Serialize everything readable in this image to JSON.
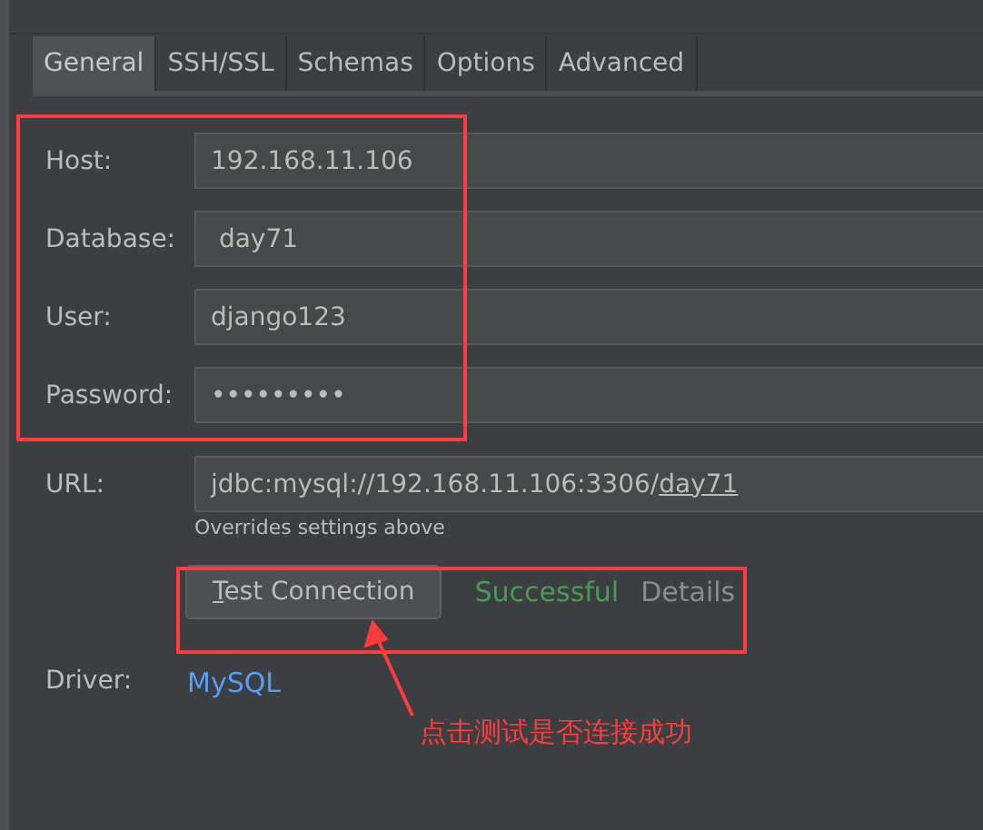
{
  "tabs": [
    {
      "label": "General",
      "selected": true
    },
    {
      "label": "SSH/SSL",
      "selected": false
    },
    {
      "label": "Schemas",
      "selected": false
    },
    {
      "label": "Options",
      "selected": false
    },
    {
      "label": "Advanced",
      "selected": false
    }
  ],
  "fields": [
    {
      "label": "Host:",
      "value": "192.168.11.106"
    },
    {
      "label": "Database:",
      "value": " day71"
    },
    {
      "label": "User:",
      "value": "django123"
    },
    {
      "label": "Password:",
      "value": "•••••••••"
    }
  ],
  "url": {
    "label": "URL:",
    "value": "jdbc:mysql://192.168.11.106:3306/",
    "underlined_part": "day71",
    "hint": "Overrides settings above"
  },
  "test": {
    "button": "Test Connection",
    "status": "Successful",
    "details": "Details"
  },
  "driver": {
    "label": "Driver:",
    "value": "MySQL"
  },
  "annotation": {
    "text": "点击测试是否连接成功"
  }
}
